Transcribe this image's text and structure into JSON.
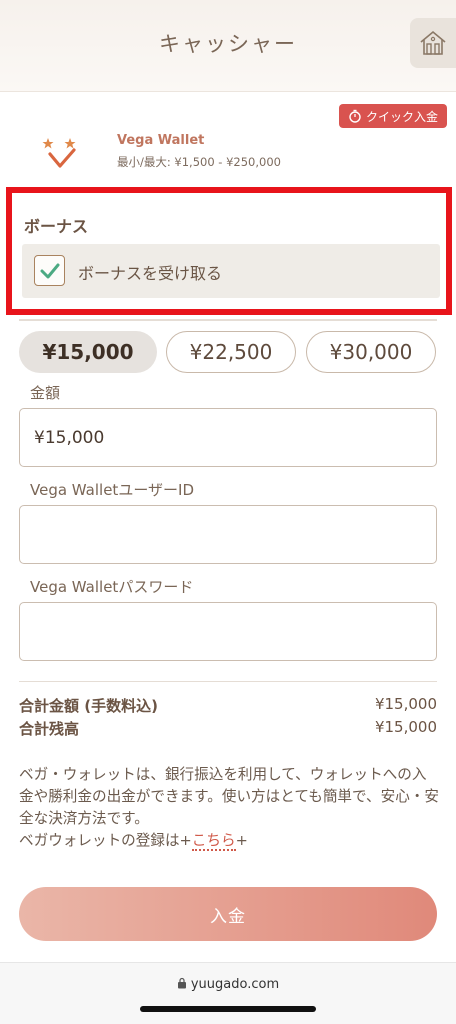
{
  "header": {
    "title": "キャッシャー",
    "home_icon": "house-icon"
  },
  "quick_deposit": {
    "label": "クイック入金",
    "icon": "stopwatch-icon",
    "color": "#d9534f"
  },
  "wallet": {
    "name": "Vega Wallet",
    "limits": "最小/最大: ¥1,500 - ¥250,000"
  },
  "bonus": {
    "title": "ボーナス",
    "checkbox_label": "ボーナスを受け取る",
    "checked": true
  },
  "amount_options": [
    "¥15,000",
    "¥22,500",
    "¥30,000"
  ],
  "form": {
    "amount_label": "金額",
    "amount_value": "¥15,000",
    "user_id_label": "Vega WalletユーザーID",
    "user_id_value": "",
    "password_label": "Vega Walletパスワード",
    "password_value": ""
  },
  "summary": {
    "total_label": "合計金額 (手数料込)",
    "total_value": "¥15,000",
    "balance_label": "合計残高",
    "balance_value": "¥15,000"
  },
  "description": {
    "text": "ベガ・ウォレットは、銀行振込を利用して、ウォレットへの入金や勝利金の出金ができます。使い方はとても簡単で、安心・安全な決済方法です。",
    "register_prefix": "ベガウォレットの登録は+",
    "register_link": "こちら",
    "register_suffix": "+"
  },
  "submit": {
    "label": "入金"
  },
  "browser": {
    "url": "yuugado.com"
  },
  "colors": {
    "accent": "#d05a4a",
    "highlight_border": "#e8141b",
    "brand_brown": "#6b5444"
  }
}
